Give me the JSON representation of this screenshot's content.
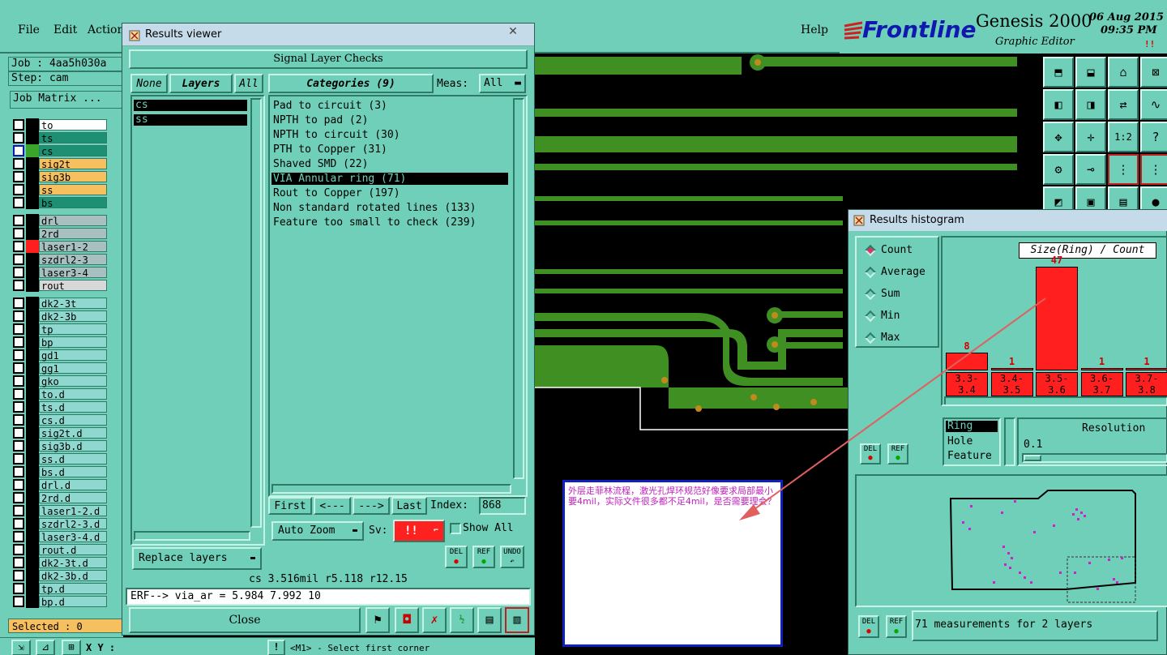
{
  "menu": {
    "file": "File",
    "edit": "Edit",
    "actions": "Action",
    "help": "Help"
  },
  "brand": {
    "logo": "Frontline",
    "product": "Genesis 2000",
    "subtitle": "Graphic Editor",
    "date": "06 Aug 2015",
    "time": "09:35 PM",
    "mark": "!!"
  },
  "job": {
    "job_label": "Job : 4aa5h030a",
    "step_label": "Step: cam",
    "matrix_btn": "Job Matrix ..."
  },
  "layers": [
    {
      "name": "to",
      "bg": "#ffffff",
      "sw": "#000000"
    },
    {
      "name": "ts",
      "bg": "#1d8f72",
      "sw": "#000000"
    },
    {
      "name": "cs",
      "bg": "#1d8f72",
      "sw": "#3aa52a",
      "active": true
    },
    {
      "name": "sig2t",
      "bg": "#f6c060",
      "sw": "#000000"
    },
    {
      "name": "sig3b",
      "bg": "#f6c060",
      "sw": "#000000"
    },
    {
      "name": "ss",
      "bg": "#f6c060",
      "sw": "#000000"
    },
    {
      "name": "bs",
      "bg": "#1d8f72",
      "sw": "#000000"
    },
    {
      "name": "drl",
      "bg": "#a8c0c0",
      "sw": "#000000"
    },
    {
      "name": "2rd",
      "bg": "#a8c0c0",
      "sw": "#000000"
    },
    {
      "name": "laser1-2",
      "bg": "#a8c0c0",
      "sw": "#ff1f1f"
    },
    {
      "name": "szdrl2-3",
      "bg": "#a8c0c0",
      "sw": "#000000"
    },
    {
      "name": "laser3-4",
      "bg": "#a8c0c0",
      "sw": "#000000"
    },
    {
      "name": "rout",
      "bg": "#d8d8d8",
      "sw": "#000000"
    },
    {
      "name": "dk2-3t",
      "bg": "#8fd8d0",
      "sw": "#000000"
    },
    {
      "name": "dk2-3b",
      "bg": "#8fd8d0",
      "sw": "#000000"
    },
    {
      "name": "tp",
      "bg": "#8fd8d0",
      "sw": "#000000"
    },
    {
      "name": "bp",
      "bg": "#8fd8d0",
      "sw": "#000000"
    },
    {
      "name": "gd1",
      "bg": "#8fd8d0",
      "sw": "#000000"
    },
    {
      "name": "gg1",
      "bg": "#8fd8d0",
      "sw": "#000000"
    },
    {
      "name": "gko",
      "bg": "#8fd8d0",
      "sw": "#000000"
    },
    {
      "name": "to.d",
      "bg": "#8fd8d0",
      "sw": "#000000"
    },
    {
      "name": "ts.d",
      "bg": "#8fd8d0",
      "sw": "#000000"
    },
    {
      "name": "cs.d",
      "bg": "#8fd8d0",
      "sw": "#000000"
    },
    {
      "name": "sig2t.d",
      "bg": "#8fd8d0",
      "sw": "#000000"
    },
    {
      "name": "sig3b.d",
      "bg": "#8fd8d0",
      "sw": "#000000"
    },
    {
      "name": "ss.d",
      "bg": "#8fd8d0",
      "sw": "#000000"
    },
    {
      "name": "bs.d",
      "bg": "#8fd8d0",
      "sw": "#000000"
    },
    {
      "name": "drl.d",
      "bg": "#8fd8d0",
      "sw": "#000000"
    },
    {
      "name": "2rd.d",
      "bg": "#8fd8d0",
      "sw": "#000000"
    },
    {
      "name": "laser1-2.d",
      "bg": "#8fd8d0",
      "sw": "#000000"
    },
    {
      "name": "szdrl2-3.d",
      "bg": "#8fd8d0",
      "sw": "#000000"
    },
    {
      "name": "laser3-4.d",
      "bg": "#8fd8d0",
      "sw": "#000000"
    },
    {
      "name": "rout.d",
      "bg": "#8fd8d0",
      "sw": "#000000"
    },
    {
      "name": "dk2-3t.d",
      "bg": "#8fd8d0",
      "sw": "#000000"
    },
    {
      "name": "dk2-3b.d",
      "bg": "#8fd8d0",
      "sw": "#000000"
    },
    {
      "name": "tp.d",
      "bg": "#8fd8d0",
      "sw": "#000000"
    },
    {
      "name": "bp.d",
      "bg": "#8fd8d0",
      "sw": "#000000"
    }
  ],
  "status": {
    "selected": "Selected : 0",
    "xy": "X Y :",
    "prompt": "<M1> - Select first corner"
  },
  "rv": {
    "title": "Results viewer",
    "header": "Signal Layer Checks",
    "none_btn": "None",
    "layers_btn": "Layers",
    "all_btn": "All",
    "categories_btn": "Categories (9)",
    "meas_label": "Meas:",
    "meas_value": "All",
    "layer_items": [
      "cs",
      "ss"
    ],
    "categories": [
      "Pad to circuit (3)",
      "NPTH to pad (2)",
      "NPTH to circuit (30)",
      "PTH to Copper (31)",
      "Shaved SMD (22)",
      "VIA Annular ring (71)",
      "Rout to Copper (197)",
      "Non standard rotated lines (133)",
      "Feature too small to check (239)"
    ],
    "first": "First",
    "prev": "<---",
    "next": "--->",
    "last": "Last",
    "index_label": "Index:",
    "index_value": "868",
    "auto_zoom": "Auto Zoom",
    "sv_label": "Sv:",
    "sv_value": "!!",
    "show_all": "Show All",
    "replace_layers": "Replace layers",
    "del": "DEL",
    "ref": "REF",
    "undo": "UNDO",
    "info": "cs 3.516mil   r5.118  r12.15",
    "erf": "ERF--> via_ar = 5.984 7.992 10",
    "close": "Close"
  },
  "rh": {
    "title": "Results histogram",
    "options": [
      "Count",
      "Average",
      "Sum",
      "Min",
      "Max"
    ],
    "chart_title": "Size(Ring) / Count",
    "field_options": [
      "Ring",
      "Hole",
      "Feature"
    ],
    "resolution_label": "Resolution",
    "resolution_value": "0.1",
    "summary": "71 measurements for 2 layers",
    "del": "DEL",
    "ref": "REF"
  },
  "chart_data": {
    "type": "bar",
    "title": "Size(Ring) / Count",
    "categories": [
      "3.3-3.4",
      "3.4-3.5",
      "3.5-3.6",
      "3.6-3.7",
      "3.7-3.8"
    ],
    "values": [
      8,
      1,
      47,
      1,
      1
    ],
    "ylim": [
      0,
      47
    ]
  },
  "note": {
    "text": "外层走菲林流程，激光孔焊环规范好像要求局部最小要4mil，实际文件很多都不足4mil，是否需要理会？"
  }
}
